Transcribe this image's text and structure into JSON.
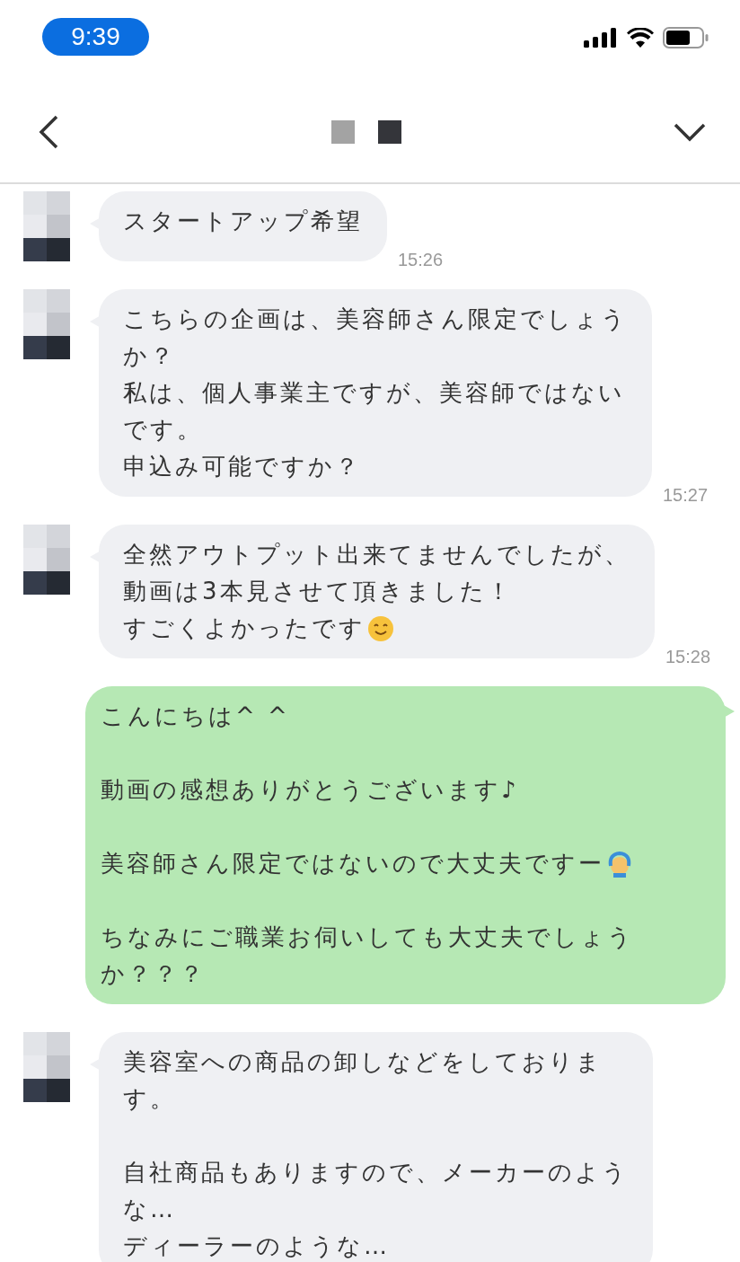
{
  "status_bar": {
    "time": "9:39"
  },
  "messages": [
    {
      "kind": "incoming",
      "time": "15:26",
      "paragraphs": [
        {
          "lines": [
            {
              "text": "スタートアップ希望"
            }
          ]
        }
      ]
    },
    {
      "kind": "incoming",
      "time": "15:27",
      "paragraphs": [
        {
          "lines": [
            {
              "text": "こちらの企画は、美容師さん限定でしょう"
            },
            {
              "text": "か？"
            },
            {
              "text": "私は、個人事業主ですが、美容師ではない"
            },
            {
              "text": "です。"
            },
            {
              "text": "申込み可能ですか？"
            }
          ]
        }
      ]
    },
    {
      "kind": "incoming",
      "time": "15:28",
      "paragraphs": [
        {
          "lines": [
            {
              "text": "全然アウトプット出来てませんでしたが、"
            },
            {
              "text": "動画は3本見させて頂きました！"
            },
            {
              "text": "すごくよかったです",
              "smiley_emoji": true
            }
          ]
        }
      ]
    },
    {
      "kind": "outgoing",
      "paragraphs": [
        {
          "lines": [
            {
              "text": "こんにちは^ ^"
            }
          ]
        },
        {
          "lines": [
            {
              "text": "動画の感想ありがとうございます♪"
            }
          ]
        },
        {
          "lines": [
            {
              "text": "美容師さん限定ではないので大丈夫ですー",
              "person_emoji": true
            }
          ]
        },
        {
          "lines": [
            {
              "text": "ちなみにご職業お伺いしても大丈夫でしょう"
            },
            {
              "text": "か？？？"
            }
          ]
        }
      ]
    },
    {
      "kind": "incoming",
      "paragraphs": [
        {
          "lines": [
            {
              "text": "美容室への商品の卸しなどをしておりま"
            },
            {
              "text": "す。"
            }
          ]
        },
        {
          "lines": [
            {
              "text": "自社商品もありますので、メーカーのよう"
            },
            {
              "text": "な…"
            },
            {
              "text": "ディーラーのような…"
            }
          ]
        }
      ]
    }
  ]
}
